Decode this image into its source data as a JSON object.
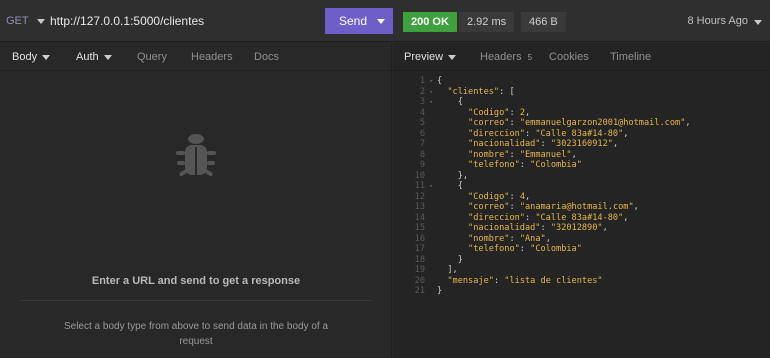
{
  "request": {
    "method": "GET",
    "url": "http://127.0.0.1:5000/clientes",
    "send_label": "Send"
  },
  "response_meta": {
    "status": "200 OK",
    "time": "2.92 ms",
    "size": "466 B",
    "time_ago": "8 Hours Ago"
  },
  "left_tabs": [
    {
      "label": "Body"
    },
    {
      "label": "Auth"
    },
    {
      "label": "Query"
    },
    {
      "label": "Headers"
    },
    {
      "label": "Docs"
    }
  ],
  "right_tabs": [
    {
      "label": "Preview"
    },
    {
      "label": "Headers",
      "badge": "5"
    },
    {
      "label": "Cookies"
    },
    {
      "label": "Timeline"
    }
  ],
  "empty_state": {
    "title": "Enter a URL and send to get a response",
    "hint": "Select a body type from above to send data in the body of a request"
  },
  "colors": {
    "send": "#6e5ec7",
    "status_ok": "#3ea13e",
    "json_string": "#e8b64b"
  },
  "response_lines": [
    {
      "n": "1",
      "fold": "▾",
      "parts": [
        [
          "p",
          "{"
        ]
      ]
    },
    {
      "n": "2",
      "fold": "▾",
      "parts": [
        [
          "p",
          "  "
        ],
        [
          "k",
          "\"clientes\""
        ],
        [
          "p",
          ": ["
        ]
      ]
    },
    {
      "n": "3",
      "fold": "▾",
      "parts": [
        [
          "p",
          "    {"
        ]
      ]
    },
    {
      "n": "4",
      "fold": "",
      "parts": [
        [
          "p",
          "      "
        ],
        [
          "k",
          "\"Codigo\""
        ],
        [
          "p",
          ": "
        ],
        [
          "n",
          "2"
        ],
        [
          "p",
          ","
        ]
      ]
    },
    {
      "n": "5",
      "fold": "",
      "parts": [
        [
          "p",
          "      "
        ],
        [
          "k",
          "\"correo\""
        ],
        [
          "p",
          ": "
        ],
        [
          "s",
          "\"emmanuelgarzon2001@hotmail.com\""
        ],
        [
          "p",
          ","
        ]
      ]
    },
    {
      "n": "6",
      "fold": "",
      "parts": [
        [
          "p",
          "      "
        ],
        [
          "k",
          "\"direccion\""
        ],
        [
          "p",
          ": "
        ],
        [
          "s",
          "\"Calle 83a#14-80\""
        ],
        [
          "p",
          ","
        ]
      ]
    },
    {
      "n": "7",
      "fold": "",
      "parts": [
        [
          "p",
          "      "
        ],
        [
          "k",
          "\"nacionalidad\""
        ],
        [
          "p",
          ": "
        ],
        [
          "s",
          "\"3023160912\""
        ],
        [
          "p",
          ","
        ]
      ]
    },
    {
      "n": "8",
      "fold": "",
      "parts": [
        [
          "p",
          "      "
        ],
        [
          "k",
          "\"nombre\""
        ],
        [
          "p",
          ": "
        ],
        [
          "s",
          "\"Emmanuel\""
        ],
        [
          "p",
          ","
        ]
      ]
    },
    {
      "n": "9",
      "fold": "",
      "parts": [
        [
          "p",
          "      "
        ],
        [
          "k",
          "\"telefono\""
        ],
        [
          "p",
          ": "
        ],
        [
          "s",
          "\"Colombia\""
        ]
      ]
    },
    {
      "n": "10",
      "fold": "",
      "parts": [
        [
          "p",
          "    },"
        ]
      ]
    },
    {
      "n": "11",
      "fold": "▾",
      "parts": [
        [
          "p",
          "    {"
        ]
      ]
    },
    {
      "n": "12",
      "fold": "",
      "parts": [
        [
          "p",
          "      "
        ],
        [
          "k",
          "\"Codigo\""
        ],
        [
          "p",
          ": "
        ],
        [
          "n",
          "4"
        ],
        [
          "p",
          ","
        ]
      ]
    },
    {
      "n": "13",
      "fold": "",
      "parts": [
        [
          "p",
          "      "
        ],
        [
          "k",
          "\"correo\""
        ],
        [
          "p",
          ": "
        ],
        [
          "s",
          "\"anamaria@hotmail.com\""
        ],
        [
          "p",
          ","
        ]
      ]
    },
    {
      "n": "14",
      "fold": "",
      "parts": [
        [
          "p",
          "      "
        ],
        [
          "k",
          "\"direccion\""
        ],
        [
          "p",
          ": "
        ],
        [
          "s",
          "\"Calle 83a#14-80\""
        ],
        [
          "p",
          ","
        ]
      ]
    },
    {
      "n": "15",
      "fold": "",
      "parts": [
        [
          "p",
          "      "
        ],
        [
          "k",
          "\"nacionalidad\""
        ],
        [
          "p",
          ": "
        ],
        [
          "s",
          "\"32012890\""
        ],
        [
          "p",
          ","
        ]
      ]
    },
    {
      "n": "16",
      "fold": "",
      "parts": [
        [
          "p",
          "      "
        ],
        [
          "k",
          "\"nombre\""
        ],
        [
          "p",
          ": "
        ],
        [
          "s",
          "\"Ana\""
        ],
        [
          "p",
          ","
        ]
      ]
    },
    {
      "n": "17",
      "fold": "",
      "parts": [
        [
          "p",
          "      "
        ],
        [
          "k",
          "\"telefono\""
        ],
        [
          "p",
          ": "
        ],
        [
          "s",
          "\"Colombia\""
        ]
      ]
    },
    {
      "n": "18",
      "fold": "",
      "parts": [
        [
          "p",
          "    }"
        ]
      ]
    },
    {
      "n": "19",
      "fold": "",
      "parts": [
        [
          "p",
          "  ],"
        ]
      ]
    },
    {
      "n": "20",
      "fold": "",
      "parts": [
        [
          "p",
          "  "
        ],
        [
          "k",
          "\"mensaje\""
        ],
        [
          "p",
          ": "
        ],
        [
          "s",
          "\"lista de clientes\""
        ]
      ]
    },
    {
      "n": "21",
      "fold": "",
      "parts": [
        [
          "p",
          "}"
        ]
      ]
    }
  ]
}
